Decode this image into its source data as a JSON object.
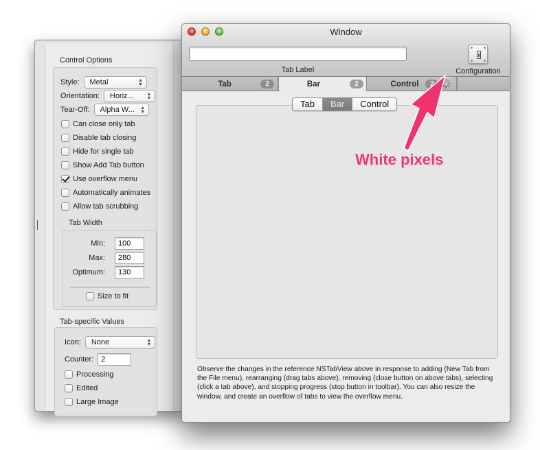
{
  "inspector": {
    "control_options": {
      "title": "Control Options",
      "style": {
        "label": "Style:",
        "value": "Metal"
      },
      "orientation": {
        "label": "Orientation:",
        "value": "Horiz..."
      },
      "tear_off": {
        "label": "Tear-Off:",
        "value": "Alpha W..."
      },
      "checkboxes": [
        {
          "label": "Can close only tab",
          "checked": false
        },
        {
          "label": "Disable tab closing",
          "checked": false
        },
        {
          "label": "Hide for single tab",
          "checked": false
        },
        {
          "label": "Show Add Tab button",
          "checked": false
        },
        {
          "label": "Use overflow menu",
          "checked": true
        },
        {
          "label": "Automatically animates",
          "checked": false
        },
        {
          "label": "Allow tab scrubbing",
          "checked": false
        }
      ],
      "tab_width": {
        "title": "Tab Width",
        "min": {
          "label": "Min:",
          "value": "100"
        },
        "max": {
          "label": "Max:",
          "value": "280"
        },
        "optimum": {
          "label": "Optimum:",
          "value": "130"
        },
        "size_to_fit": {
          "label": "Size to fit",
          "checked": false
        }
      }
    },
    "tab_specific": {
      "title": "Tab-specific Values",
      "icon": {
        "label": "Icon:",
        "value": "None"
      },
      "counter": {
        "label": "Counter:",
        "value": "2"
      },
      "checkboxes": [
        {
          "label": "Processing",
          "checked": false
        },
        {
          "label": "Edited",
          "checked": false
        },
        {
          "label": "Large Image",
          "checked": false
        }
      ]
    }
  },
  "window": {
    "title": "Window",
    "toolbar": {
      "tab_label_value": "",
      "tab_label_caption": "Tab Label",
      "configuration_label": "Configuration",
      "configuration_icon": "toggle-switch-icon"
    },
    "tabs": [
      {
        "label": "Tab",
        "count": "2",
        "selected": false
      },
      {
        "label": "Bar",
        "count": "2",
        "selected": true
      },
      {
        "label": "Control",
        "count": "2",
        "selected": false,
        "processing": true
      }
    ],
    "segmented": [
      {
        "label": "Tab",
        "selected": false
      },
      {
        "label": "Bar",
        "selected": true
      },
      {
        "label": "Control",
        "selected": false
      }
    ],
    "description": "Observe the changes in the reference NSTabView above in response to adding (New Tab from the File menu), rearranging (drag tabs above), removing (close button on above tabs), selecting (click a tab above), and stopping progress (stop button in toolbar).  You can also resize the window, and create an overflow of tabs to view the overflow menu."
  },
  "annotation": {
    "text": "White pixels",
    "color": "#f0326e"
  }
}
